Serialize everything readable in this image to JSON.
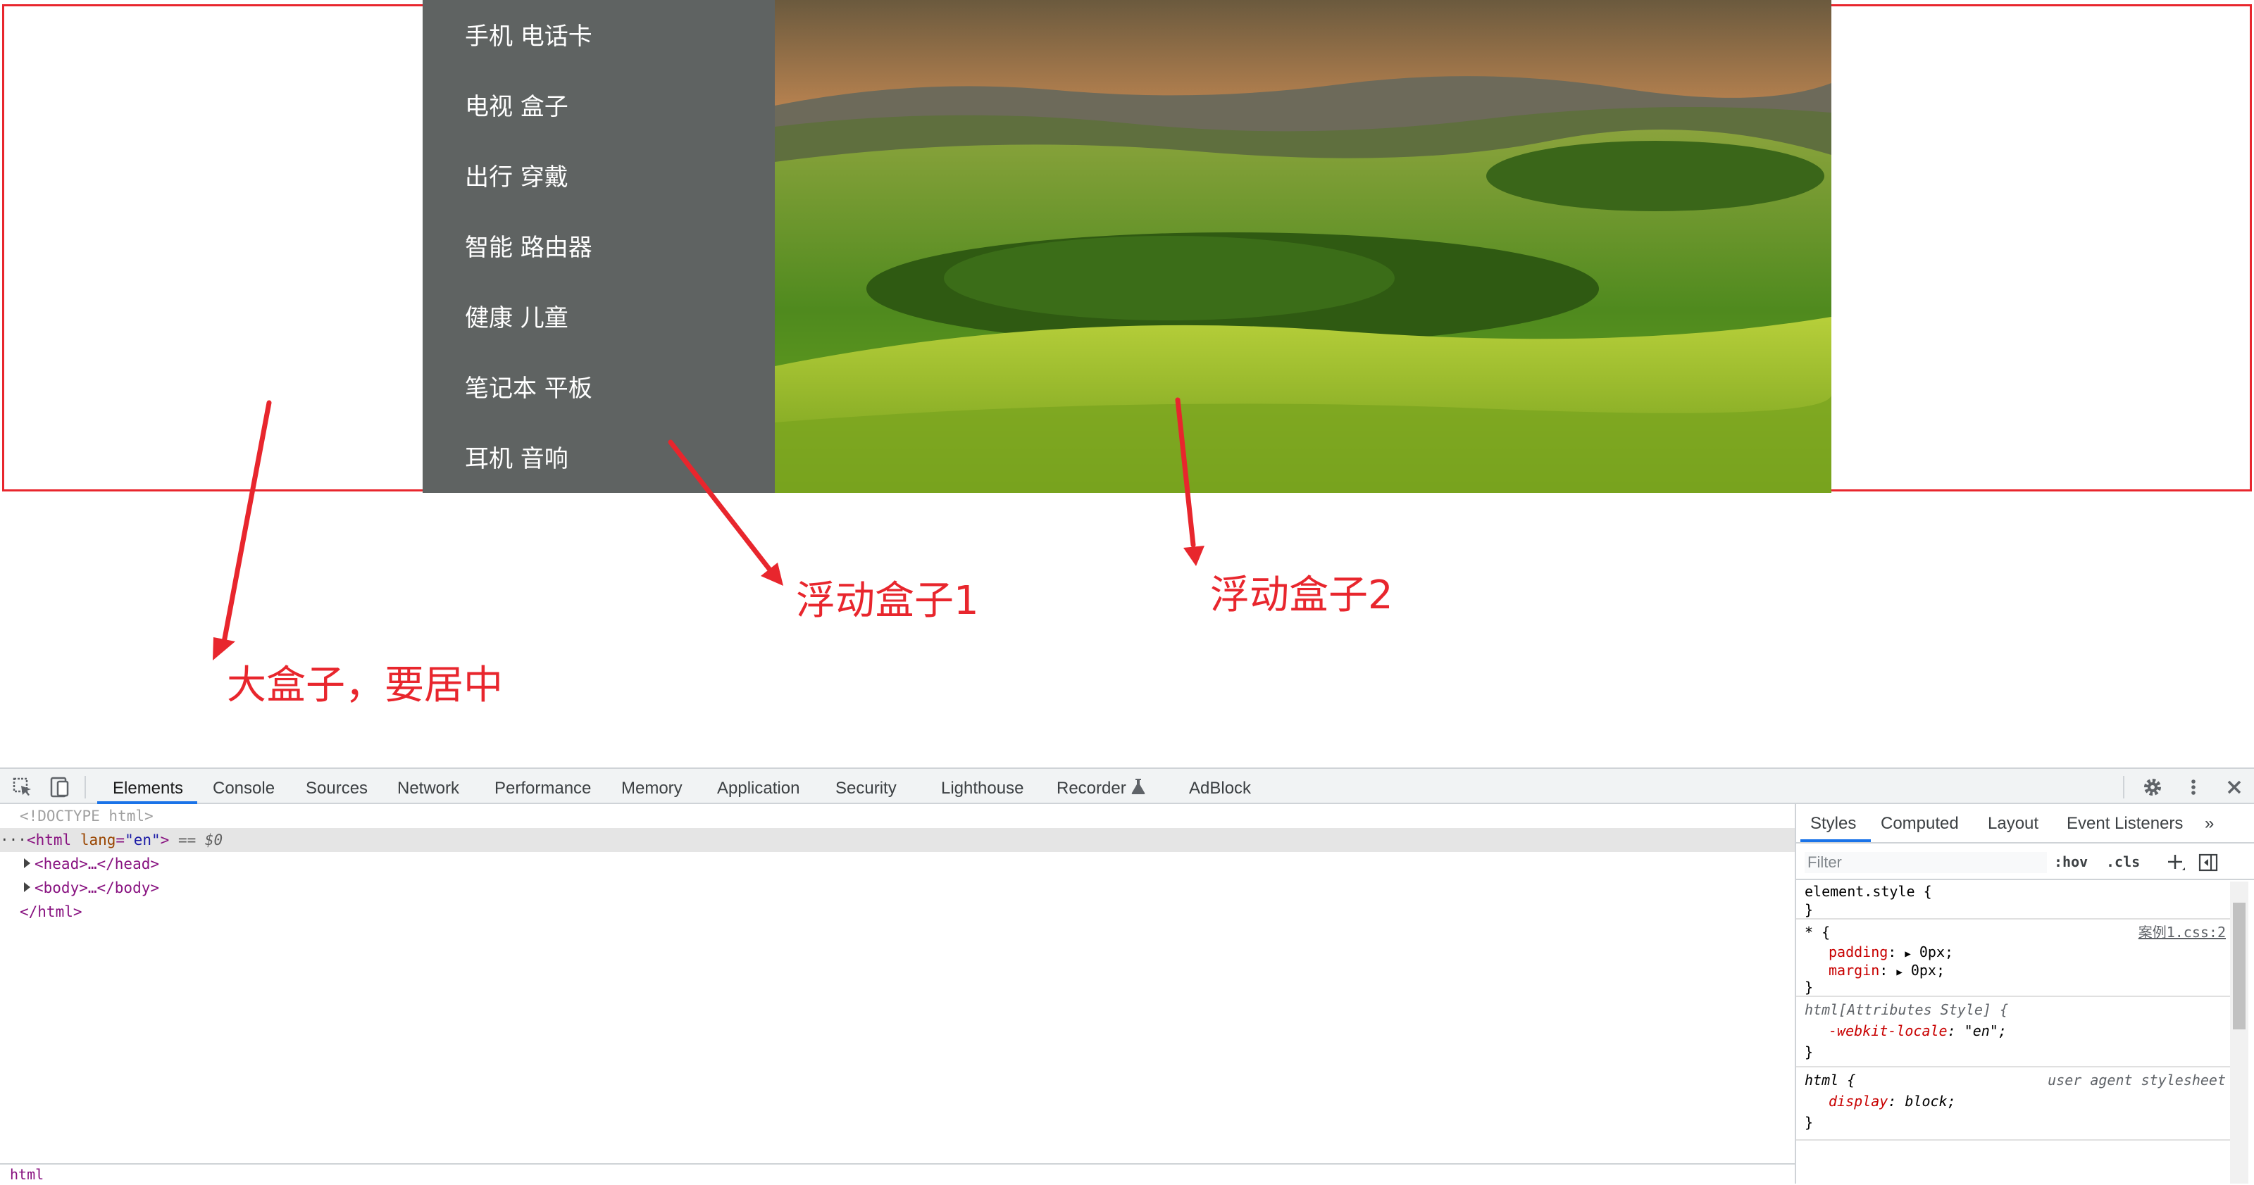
{
  "menu": {
    "items": [
      "手机 电话卡",
      "电视 盒子",
      "出行 穿戴",
      "智能 路由器",
      "健康 儿童",
      "笔记本 平板",
      "耳机 音响"
    ]
  },
  "annotations": {
    "big_box": "大盒子，要居中",
    "float1": "浮动盒子1",
    "float2": "浮动盒子2"
  },
  "colors": {
    "annotation_red": "#e8262d",
    "menu_bg": "#5f6362",
    "devtools_accent": "#1a73e8"
  },
  "devtools": {
    "tabs": [
      "Elements",
      "Console",
      "Sources",
      "Network",
      "Performance",
      "Memory",
      "Application",
      "Security",
      "Lighthouse",
      "Recorder",
      "AdBlock"
    ],
    "active_tab": "Elements",
    "icons": [
      "inspect-icon",
      "device-toolbar-icon",
      "recorder-flask-icon",
      "settings-gear-icon",
      "more-vertical-icon",
      "close-icon"
    ],
    "dom": {
      "doctype": "<!DOCTYPE html>",
      "html_open_tag": "html",
      "html_attr_name": "lang",
      "html_attr_value": "\"en\"",
      "html_eq": "== $0",
      "head": "<head>…</head>",
      "body": "<body>…</body>",
      "html_close": "</html>"
    },
    "breadcrumb": "html",
    "styles": {
      "tabs": [
        "Styles",
        "Computed",
        "Layout",
        "Event Listeners"
      ],
      "more": "»",
      "filter_placeholder": "Filter",
      "hov": ":hov",
      "cls": ".cls",
      "rules": {
        "element_style": "element.style {",
        "star_selector": "* {",
        "star_source": "案例1.css:2",
        "padding_name": "padding",
        "padding_value": "0px;",
        "margin_name": "margin",
        "margin_value": "0px;",
        "html_attr_selector": "html[Attributes Style] {",
        "locale_name": "-webkit-locale",
        "locale_value": "\"en\";",
        "html_selector": "html {",
        "ua_source": "user agent stylesheet",
        "display_name": "display",
        "display_value": "block;",
        "close_brace": "}"
      }
    }
  }
}
